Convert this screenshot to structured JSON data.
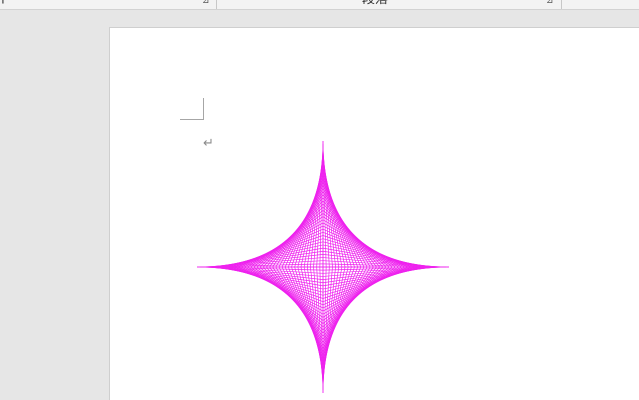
{
  "ribbon": {
    "left_group_label": "ト",
    "paragraph_group_label": "段落",
    "launcher_icon": "dialog-launcher-icon",
    "launcher_glyph": "⊿"
  },
  "document": {
    "paragraph_mark": "↵",
    "shape": {
      "type": "astroid-string-art",
      "stroke_color": "#ee22ee",
      "line_count": 40
    }
  }
}
